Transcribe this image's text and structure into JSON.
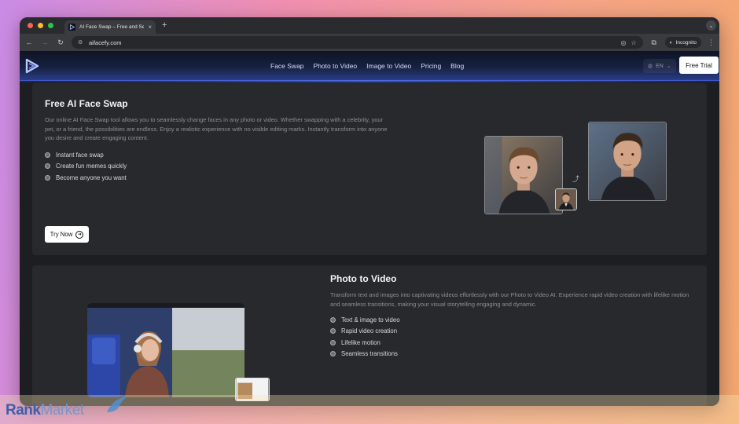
{
  "browser": {
    "tab_title": "AI Face Swap – Free and Sec",
    "url": "aifacefy.com",
    "incognito_label": "Incognito",
    "tab_close_icon": "×",
    "new_tab_icon": "+"
  },
  "site": {
    "nav": {
      "links": [
        "Face Swap",
        "Photo to Video",
        "Image to Video",
        "Pricing",
        "Blog"
      ],
      "lang": "EN",
      "cta": "Free Trial"
    },
    "face_swap": {
      "title": "Free AI Face Swap",
      "description": "Our online AI Face Swap tool allows you to seamlessly change faces in any photo or video. Whether swapping with a celebrity, your pet, or a friend, the possibilities are endless. Enjoy a realistic experience with no visible editing marks. Instantly transform into anyone you desire and create engaging content.",
      "features": [
        "Instant face swap",
        "Create fun memes quickly",
        "Become anyone you want"
      ],
      "button": "Try Now"
    },
    "photo_to_video": {
      "title": "Photo to Video",
      "description": "Transform text and images into captivating videos effortlessly with our Photo to Video AI. Experience rapid video creation with lifelike motion and seamless transitions, making your visual storytelling engaging and dynamic.",
      "features": [
        "Text & image to video",
        "Rapid video creation",
        "Lifelike motion",
        "Seamless transitions"
      ]
    }
  },
  "watermark": {
    "brand_a": "Rank",
    "brand_b": "Market"
  },
  "colors": {
    "accent_nav": "#2a3d86",
    "panel": "#28292c",
    "page": "#1d1e21"
  },
  "icons": [
    "browser-back-icon",
    "browser-forward-icon",
    "reload-icon",
    "eye-off-icon",
    "star-icon",
    "extensions-icon",
    "incognito-icon",
    "kebab-icon",
    "logo-icon",
    "globe-icon",
    "arrow-right-circle-icon",
    "swap-arrow-icon"
  ]
}
